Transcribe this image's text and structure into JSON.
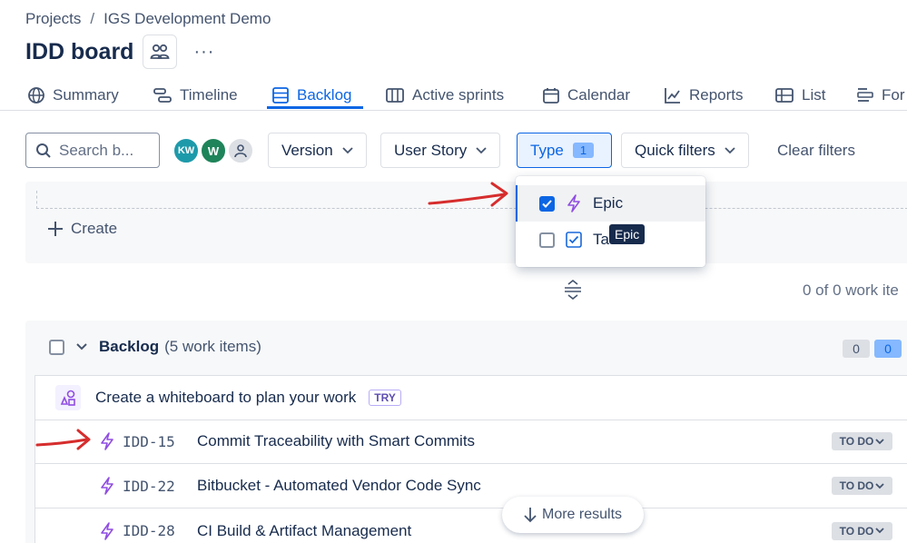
{
  "breadcrumb": {
    "projects": "Projects",
    "separator": "/",
    "project": "IGS Development Demo"
  },
  "page": {
    "title": "IDD board",
    "more": "···"
  },
  "tabs": [
    {
      "label": "Summary",
      "icon": "globe-icon"
    },
    {
      "label": "Timeline",
      "icon": "timeline-icon"
    },
    {
      "label": "Backlog",
      "icon": "backlog-icon",
      "active": true
    },
    {
      "label": "Active sprints",
      "icon": "columns-icon"
    },
    {
      "label": "Calendar",
      "icon": "calendar-icon"
    },
    {
      "label": "Reports",
      "icon": "chart-icon"
    },
    {
      "label": "List",
      "icon": "list-icon"
    },
    {
      "label": "For",
      "icon": "form-icon"
    }
  ],
  "filters": {
    "search_placeholder": "Search b...",
    "avatars": [
      {
        "initials": "KW",
        "color": "#1d9aaa"
      },
      {
        "initials": "W",
        "color": "#1f845a"
      }
    ],
    "version": "Version",
    "user_story": "User Story",
    "type": "Type",
    "type_count": "1",
    "quick_filters": "Quick filters",
    "clear": "Clear filters"
  },
  "type_dropdown": {
    "items": [
      {
        "label": "Epic",
        "checked": true
      },
      {
        "label": "Ta",
        "checked": false
      }
    ],
    "tooltip": "Epic"
  },
  "sprint": {
    "create": "Create",
    "count_text": "0 of 0 work ite"
  },
  "backlog": {
    "title": "Backlog",
    "subtitle": "(5 work items)",
    "count_todo": "0",
    "count_progress": "0",
    "whiteboard": {
      "label": "Create a whiteboard to plan your work",
      "badge": "TRY"
    },
    "items": [
      {
        "key": "IDD-15",
        "summary": "Commit Traceability with Smart Commits",
        "status": "TO DO"
      },
      {
        "key": "IDD-22",
        "summary": "Bitbucket - Automated Vendor Code Sync",
        "status": "TO DO"
      },
      {
        "key": "IDD-28",
        "summary": "CI Build & Artifact Management",
        "status": "TO DO"
      }
    ],
    "more_results": "More results"
  },
  "colors": {
    "accent": "#0c66e4",
    "epic": "#904ee2",
    "annotation": "#d62d2d"
  }
}
